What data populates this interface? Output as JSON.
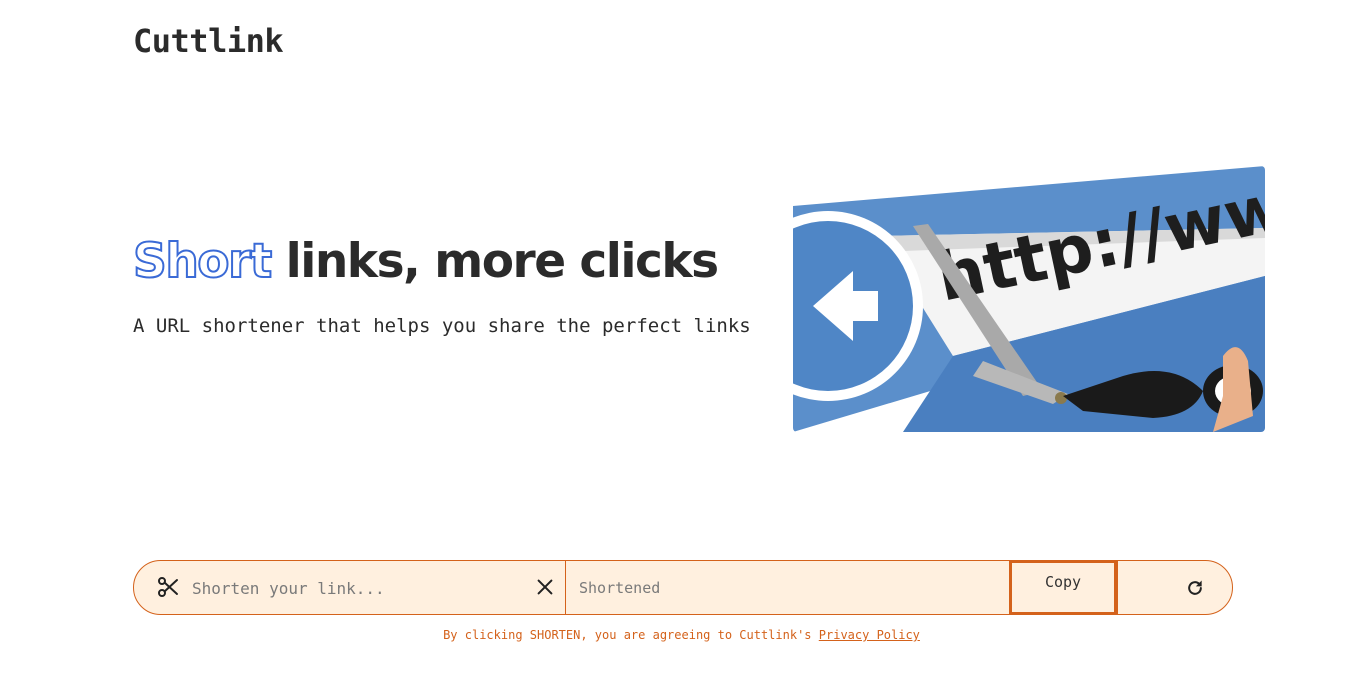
{
  "header": {
    "logo": "Cuttlink"
  },
  "hero": {
    "title_highlight": "Short",
    "title_rest": "links, more clicks",
    "subtitle": "A URL shortener that helps you share the perfect links",
    "image_text": "http://www."
  },
  "shortener": {
    "input_placeholder": "Shorten your link...",
    "output_placeholder": "Shortened",
    "copy_label": "Copy"
  },
  "footer": {
    "terms_prefix": "By clicking SHORTEN, you are agreeing to Cuttlink's ",
    "privacy_link": "Privacy Policy"
  },
  "colors": {
    "accent": "#d4621b",
    "bar_background": "#fff0df",
    "highlight_blue": "#3a6ad6"
  },
  "icons": [
    "scissors-icon",
    "close-icon",
    "refresh-icon",
    "arrow-left-icon"
  ]
}
